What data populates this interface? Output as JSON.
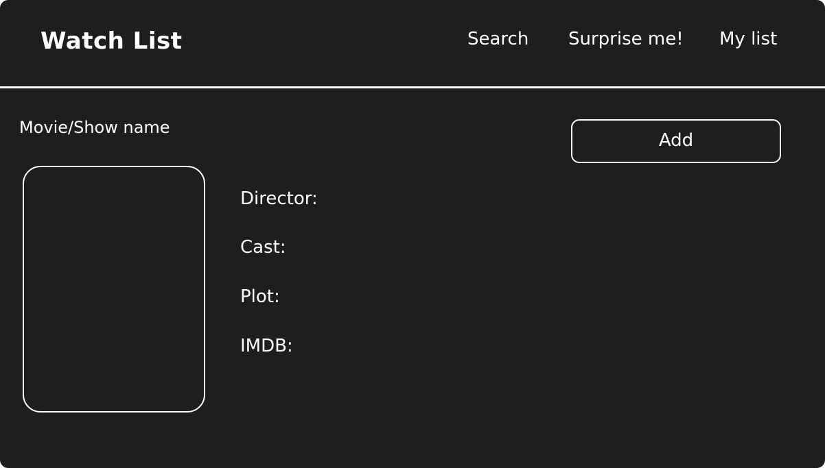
{
  "header": {
    "title": "Watch List",
    "nav": {
      "search": "Search",
      "surprise": "Surprise me!",
      "my_list": "My list"
    }
  },
  "main": {
    "title_label": "Movie/Show name",
    "add_label": "Add",
    "fields": {
      "director": "Director:",
      "cast": "Cast:",
      "plot": "Plot:",
      "imdb": "IMDB:"
    }
  },
  "colors": {
    "background": "#1e1e1e",
    "foreground": "#ffffff"
  }
}
